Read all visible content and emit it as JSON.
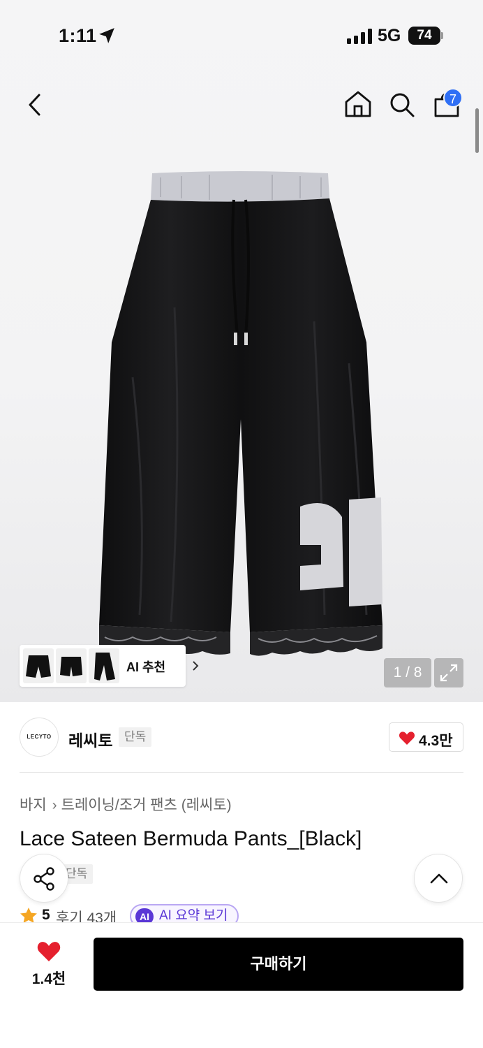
{
  "status_bar": {
    "time": "1:11",
    "network": "5G",
    "battery": "74"
  },
  "header": {
    "back_icon": "chevron-left-icon",
    "home_icon": "home-icon",
    "search_icon": "search-icon",
    "cart_icon": "shopping-bag-icon",
    "cart_count": "7"
  },
  "gallery": {
    "ai_recommend_label": "AI 추천",
    "page_indicator": "1 / 8",
    "expand_icon": "expand-icon",
    "thumbnail_count": 3
  },
  "brand": {
    "logo_text": "LECYTO",
    "name": "레씨토",
    "tag": "단독",
    "like_count": "4.3만"
  },
  "product": {
    "breadcrumb": [
      "바지",
      "트레이닝/조거 팬츠 (레씨토)"
    ],
    "title": "Lace Sateen Bermuda Pants_[Black]",
    "tag": "단독",
    "rating": "5",
    "review_label": "후기 43개",
    "ai_summary_badge": "AI",
    "ai_summary_label": "AI 요약 보기"
  },
  "bottom_bar": {
    "favorite_count": "1.4천",
    "buy_label": "구매하기"
  },
  "colors": {
    "badge_blue": "#2f6ff5",
    "heart_red": "#e5202e",
    "ai_purple": "#5a37d6",
    "buy_button": "#000000"
  }
}
